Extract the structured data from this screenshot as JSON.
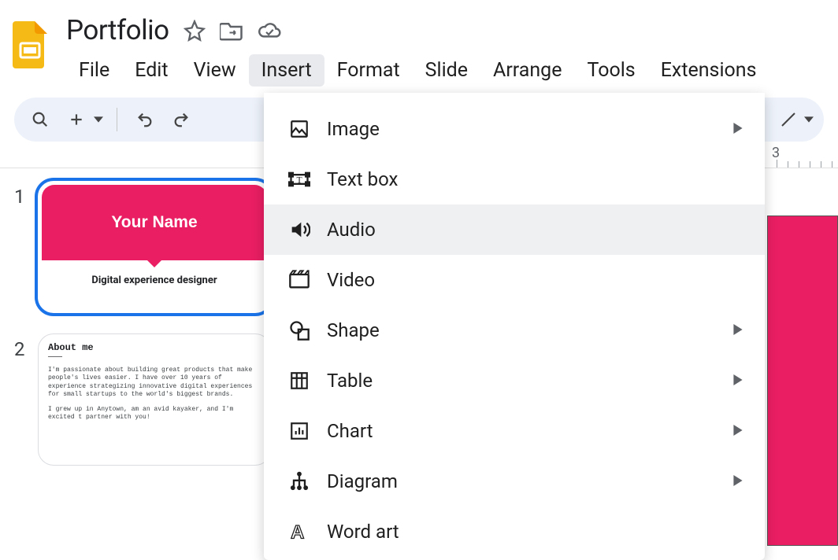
{
  "doc": {
    "title": "Portfolio"
  },
  "menubar": {
    "file": "File",
    "edit": "Edit",
    "view": "View",
    "insert": "Insert",
    "format": "Format",
    "slide": "Slide",
    "arrange": "Arrange",
    "tools": "Tools",
    "extensions": "Extensions"
  },
  "ruler": {
    "tick3": "3"
  },
  "thumbs": {
    "n1": "1",
    "n2": "2",
    "slide1_title": "Your Name",
    "slide1_subtitle": "Digital experience designer",
    "slide2_heading": "About me",
    "slide2_dashes": "———",
    "slide2_p1": "I'm passionate about building great products that make people's lives easier. I have over 10 years of experience strategizing innovative digital experiences for small startups to the world's biggest brands.",
    "slide2_p2": "I grew up in Anytown, am an avid kayaker, and I'm excited t partner with you!"
  },
  "insert_menu": {
    "image": "Image",
    "textbox": "Text box",
    "audio": "Audio",
    "video": "Video",
    "shape": "Shape",
    "table": "Table",
    "chart": "Chart",
    "diagram": "Diagram",
    "wordart": "Word art"
  }
}
